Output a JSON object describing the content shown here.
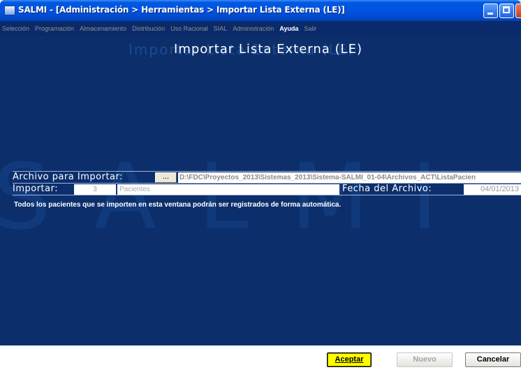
{
  "window": {
    "title": "SALMI - [Administración > Herramientas > Importar Lista Externa (LE)]",
    "icon": "app-window-icon"
  },
  "menu": [
    {
      "label": "Selección",
      "enabled": false
    },
    {
      "label": "Programación",
      "enabled": false
    },
    {
      "label": "Almacenamiento",
      "enabled": false
    },
    {
      "label": "Distribución",
      "enabled": false
    },
    {
      "label": "Uso Racional",
      "enabled": false
    },
    {
      "label": "SIAL",
      "enabled": false
    },
    {
      "label": "Administración",
      "enabled": false
    },
    {
      "label": "Ayuda",
      "enabled": true
    },
    {
      "label": "Salir",
      "enabled": false
    }
  ],
  "page": {
    "title": "Importar Lista Externa (LE)",
    "watermark": "SALMI"
  },
  "form": {
    "file_label": "Archivo para Importar:",
    "browse_label": "...",
    "file_path": "D:\\FDC\\Proyectos_2013\\Sistemas_2013\\Sistema-SALMI_01-04\\Archivos_ACT\\ListaPacien",
    "import_label": "Importar:",
    "import_count": "3",
    "import_type": "Pacientes",
    "date_label": "Fecha del Archivo:",
    "date_value": "04/01/2013"
  },
  "info": "Todos los pacientes que se importen en esta ventana podrán ser registrados de forma automática.",
  "buttons": {
    "accept": "Aceptar",
    "new": "Nuevo",
    "cancel": "Cancelar"
  },
  "colors": {
    "background": "#0c2f6c",
    "accept_button": "#FFFF00"
  }
}
